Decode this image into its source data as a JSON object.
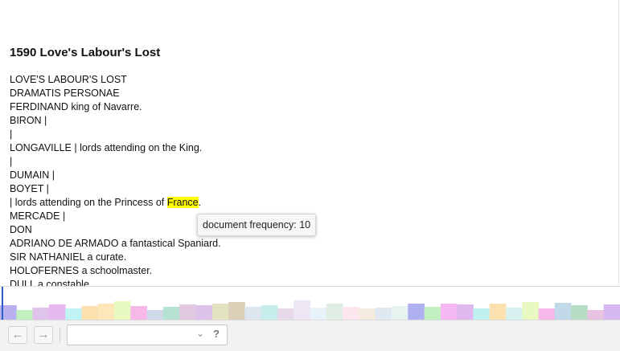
{
  "document": {
    "title": "1590 Love's Labour's Lost",
    "lines": [
      "LOVE'S LABOUR'S LOST",
      "DRAMATIS PERSONAE",
      "FERDINAND king of Navarre.",
      "BIRON |",
      "|",
      "LONGAVILLE | lords attending on the King.",
      "|",
      "DUMAIN |",
      "BOYET |",
      "| lords attending on the Princess of ",
      "MERCADE |",
      "DON",
      "ADRIANO DE ARMADO a fantastical Spaniard.",
      "SIR NATHANIEL a curate.",
      "HOLOFERNES a schoolmaster.",
      "DULL a constable."
    ],
    "highlight_term": "France",
    "highlight_suffix": ".",
    "highlight_color": "#ffff00"
  },
  "tooltip": {
    "text": "document frequency: 10"
  },
  "doc_strip": {
    "marker_color": "#2d5ec9",
    "colors": [
      "#b8b0ef",
      "#c2efc2",
      "#e0c3ea",
      "#e5b8f0",
      "#c0f3f3",
      "#fde0b0",
      "#fde6b8",
      "#e8fac2",
      "#f7b8e8",
      "#cfd9ea",
      "#b6e2d1",
      "#e0c8e0",
      "#ddc3ea",
      "#e3e3c0",
      "#dccfb8",
      "#dde6ee",
      "#c6ecec",
      "#e8d9e8",
      "#ede6f5",
      "#e8f2fa",
      "#dfede2",
      "#fde6ee",
      "#f5ece0",
      "#e0e8f2",
      "#e8f2ee",
      "#b0b0f0",
      "#c2f0c2",
      "#f5b8f5",
      "#e0b8f0",
      "#c0f0f0",
      "#fde0b0",
      "#d9f0f0",
      "#e8fac2",
      "#f5b8e8",
      "#c2d9ea",
      "#b6ddc6",
      "#e6c3e0",
      "#d8b8f0"
    ],
    "heights": [
      0.45,
      0.32,
      0.38,
      0.48,
      0.35,
      0.42,
      0.5,
      0.58,
      0.42,
      0.3,
      0.4,
      0.48,
      0.45,
      0.5,
      0.55,
      0.4,
      0.45,
      0.35,
      0.6,
      0.38,
      0.5,
      0.4,
      0.35,
      0.38,
      0.42,
      0.5,
      0.4,
      0.5,
      0.48,
      0.35,
      0.5,
      0.38,
      0.55,
      0.35,
      0.52,
      0.45,
      0.3,
      0.48
    ]
  },
  "toolbar": {
    "back_icon": "arrow-left-icon",
    "forward_icon": "arrow-right-icon",
    "back_glyph": "←",
    "forward_glyph": "→",
    "search_value": "",
    "chevron_glyph": "⌄",
    "help_label": "?"
  }
}
